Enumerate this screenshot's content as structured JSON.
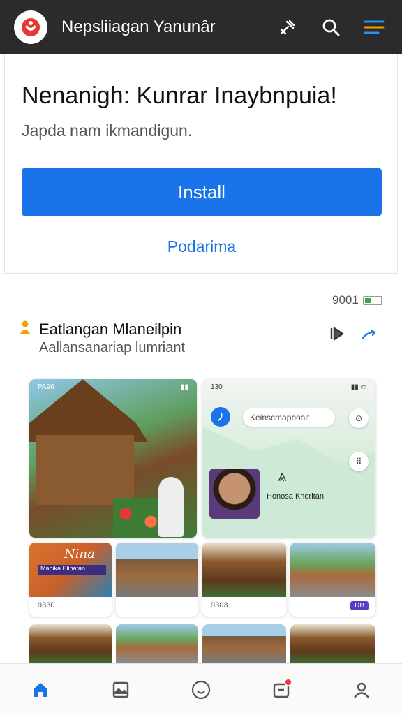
{
  "app_bar": {
    "title": "Nepsliiagan Yanunâr",
    "icons": [
      "logo-icon",
      "tools-icon",
      "search-icon",
      "filter-menu-icon"
    ]
  },
  "install_card": {
    "headline": "Nenanigh: Kunrar Inaybnpuia!",
    "subline": "Japda nam ikmandigun.",
    "install_label": "Install",
    "secondary_label": "Podarima"
  },
  "status": {
    "counter": "9001"
  },
  "section": {
    "title": "Eatlangan Mlaneilpin",
    "subtitle": "Aallansanariap lumriant",
    "icons": [
      "person-pin-icon",
      "share-icon",
      "trend-icon"
    ]
  },
  "gallery": {
    "photo_status_left": "PA96",
    "map_status_left": "130",
    "map_search": "Keinscmapboait",
    "map_label": "Honosa Knoritan",
    "tiles": [
      {
        "caption": "9330",
        "poster_title": "Nina",
        "poster_bar": "Mabika Elinatan"
      },
      {
        "caption": ""
      },
      {
        "caption": "9303"
      },
      {
        "caption": "",
        "badge": "DB"
      }
    ]
  },
  "bottom_nav": {
    "items": [
      "home-icon",
      "gallery-icon",
      "emoji-icon",
      "messages-icon",
      "profile-icon"
    ]
  },
  "colors": {
    "app_bar": "#2b2b2d",
    "accent": "#1a73e8",
    "badge": "#5b3cc4",
    "notification": "#e53935"
  }
}
